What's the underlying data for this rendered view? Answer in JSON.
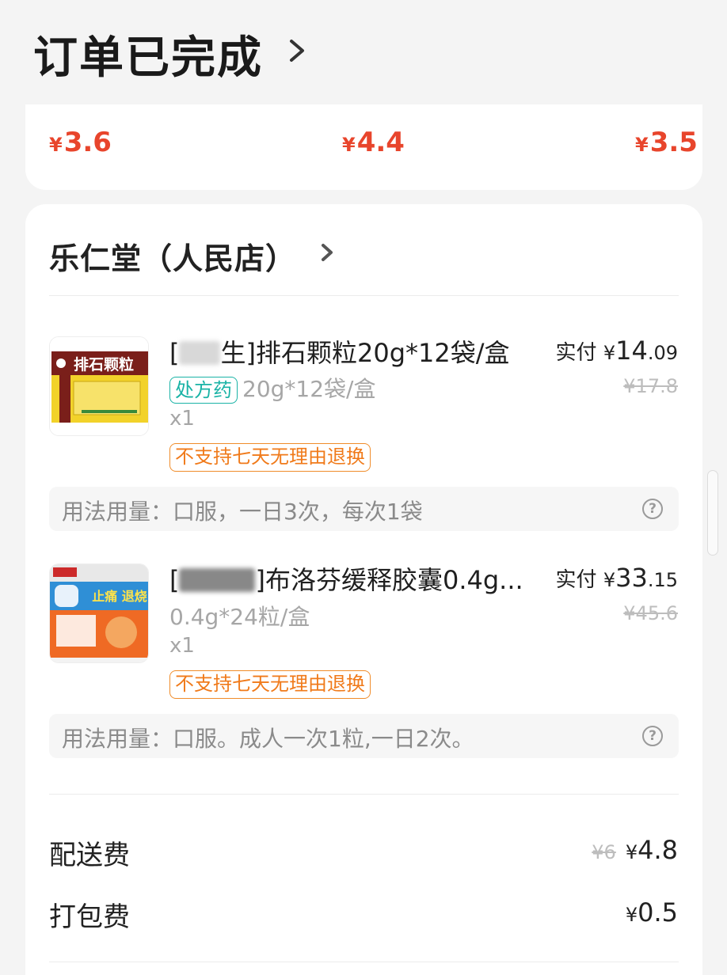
{
  "header": {
    "title": "订单已完成"
  },
  "top_prices": [
    {
      "currency": "¥",
      "value": "3.6"
    },
    {
      "currency": "¥",
      "value": "4.4"
    },
    {
      "currency": "¥",
      "value": "3.5"
    }
  ],
  "store": {
    "name": "乐仁堂（人民店）"
  },
  "items": [
    {
      "name_prefix": "[",
      "name_suffix": "生]排石颗粒20g*12袋/盒",
      "paid_label": "实付",
      "currency": "¥",
      "price_int": "14",
      "price_dec": ".09",
      "original_price": "¥17.8",
      "rx_tag": "处方药",
      "spec": "20g*12袋/盒",
      "qty": "x1",
      "return_policy": "不支持七天无理由退换",
      "usage": "用法用量：口服，一日3次，每次1袋",
      "thumb_text": "排石颗粒"
    },
    {
      "name_prefix": "[",
      "name_suffix": "]布洛芬缓释胶囊0.4g...",
      "paid_label": "实付",
      "currency": "¥",
      "price_int": "33",
      "price_dec": ".15",
      "original_price": "¥45.6",
      "spec": "0.4g*24粒/盒",
      "qty": "x1",
      "return_policy": "不支持七天无理由退换",
      "usage": "用法用量：口服。成人一次1粒,一日2次。",
      "thumb_text": "止痛 退烧"
    }
  ],
  "fees": [
    {
      "label": "配送费",
      "original": "¥6",
      "currency": "¥",
      "value": "4.8"
    },
    {
      "label": "打包费",
      "currency": "¥",
      "value": "0.5"
    }
  ],
  "help_glyph": "?",
  "colors": {
    "price_red": "#e8452c",
    "rx_teal": "#1ab3a6",
    "return_orange": "#f07a1a"
  }
}
